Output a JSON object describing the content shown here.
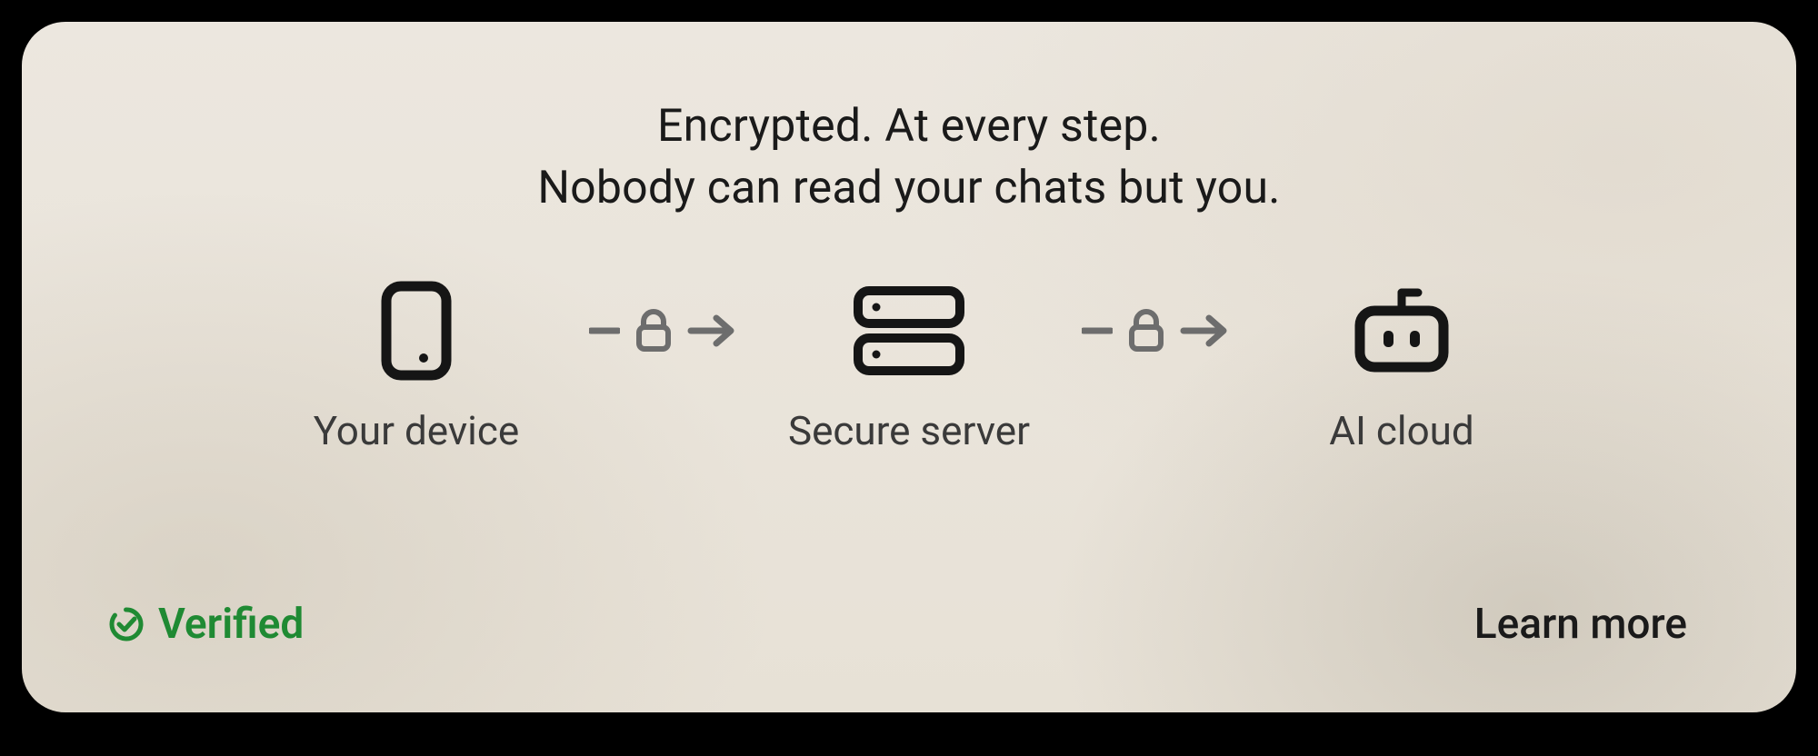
{
  "headline": {
    "line1": "Encrypted. At every step.",
    "line2": "Nobody can read your chats but you."
  },
  "flow": {
    "node1_label": "Your device",
    "node2_label": "Secure server",
    "node3_label": "AI cloud"
  },
  "footer": {
    "verified_label": "Verified",
    "learn_more_label": "Learn more"
  },
  "colors": {
    "verified_green": "#1f8a33"
  }
}
